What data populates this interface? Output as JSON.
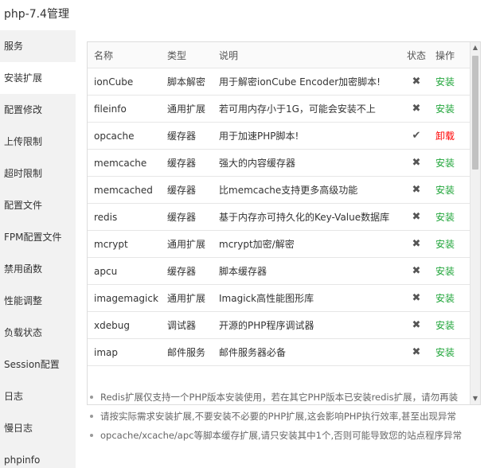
{
  "window": {
    "title": "php-7.4管理"
  },
  "sidebar": {
    "items": [
      {
        "label": "服务"
      },
      {
        "label": "安装扩展"
      },
      {
        "label": "配置修改"
      },
      {
        "label": "上传限制"
      },
      {
        "label": "超时限制"
      },
      {
        "label": "配置文件"
      },
      {
        "label": "FPM配置文件"
      },
      {
        "label": "禁用函数"
      },
      {
        "label": "性能调整"
      },
      {
        "label": "负载状态"
      },
      {
        "label": "Session配置"
      },
      {
        "label": "日志"
      },
      {
        "label": "慢日志"
      },
      {
        "label": "phpinfo"
      }
    ],
    "active_index": 1
  },
  "table": {
    "headers": {
      "name": "名称",
      "type": "类型",
      "desc": "说明",
      "status": "状态",
      "action": "操作"
    },
    "rows": [
      {
        "name": "ionCube",
        "type": "脚本解密",
        "desc": "用于解密ionCube Encoder加密脚本!",
        "status": "✖",
        "action": "安装"
      },
      {
        "name": "fileinfo",
        "type": "通用扩展",
        "desc": "若可用内存小于1G，可能会安装不上",
        "status": "✖",
        "action": "安装"
      },
      {
        "name": "opcache",
        "type": "缓存器",
        "desc": "用于加速PHP脚本!",
        "status": "✔",
        "action": "卸载"
      },
      {
        "name": "memcache",
        "type": "缓存器",
        "desc": "强大的内容缓存器",
        "status": "✖",
        "action": "安装"
      },
      {
        "name": "memcached",
        "type": "缓存器",
        "desc": "比memcache支持更多高级功能",
        "status": "✖",
        "action": "安装"
      },
      {
        "name": "redis",
        "type": "缓存器",
        "desc": "基于内存亦可持久化的Key-Value数据库",
        "status": "✖",
        "action": "安装"
      },
      {
        "name": "mcrypt",
        "type": "通用扩展",
        "desc": "mcrypt加密/解密",
        "status": "✖",
        "action": "安装"
      },
      {
        "name": "apcu",
        "type": "缓存器",
        "desc": "脚本缓存器",
        "status": "✖",
        "action": "安装"
      },
      {
        "name": "imagemagick",
        "type": "通用扩展",
        "desc": "Imagick高性能图形库",
        "status": "✖",
        "action": "安装"
      },
      {
        "name": "xdebug",
        "type": "调试器",
        "desc": "开源的PHP程序调试器",
        "status": "✖",
        "action": "安装"
      },
      {
        "name": "imap",
        "type": "邮件服务",
        "desc": "邮件服务器必备",
        "status": "✖",
        "action": "安装"
      }
    ]
  },
  "scrollbar": {
    "up_icon": "▲",
    "down_icon": "▼"
  },
  "tips": [
    "Redis扩展仅支持一个PHP版本安装使用，若在其它PHP版本已安装redis扩展，请勿再装",
    "请按实际需求安装扩展,不要安装不必要的PHP扩展,这会影响PHP执行效率,甚至出现异常",
    "opcache/xcache/apc等脚本缓存扩展,请只安装其中1个,否则可能导致您的站点程序异常"
  ],
  "colors": {
    "install": "#20a53a",
    "uninstall": "#ff0000",
    "sidebar_bg": "#f2f2f2"
  }
}
